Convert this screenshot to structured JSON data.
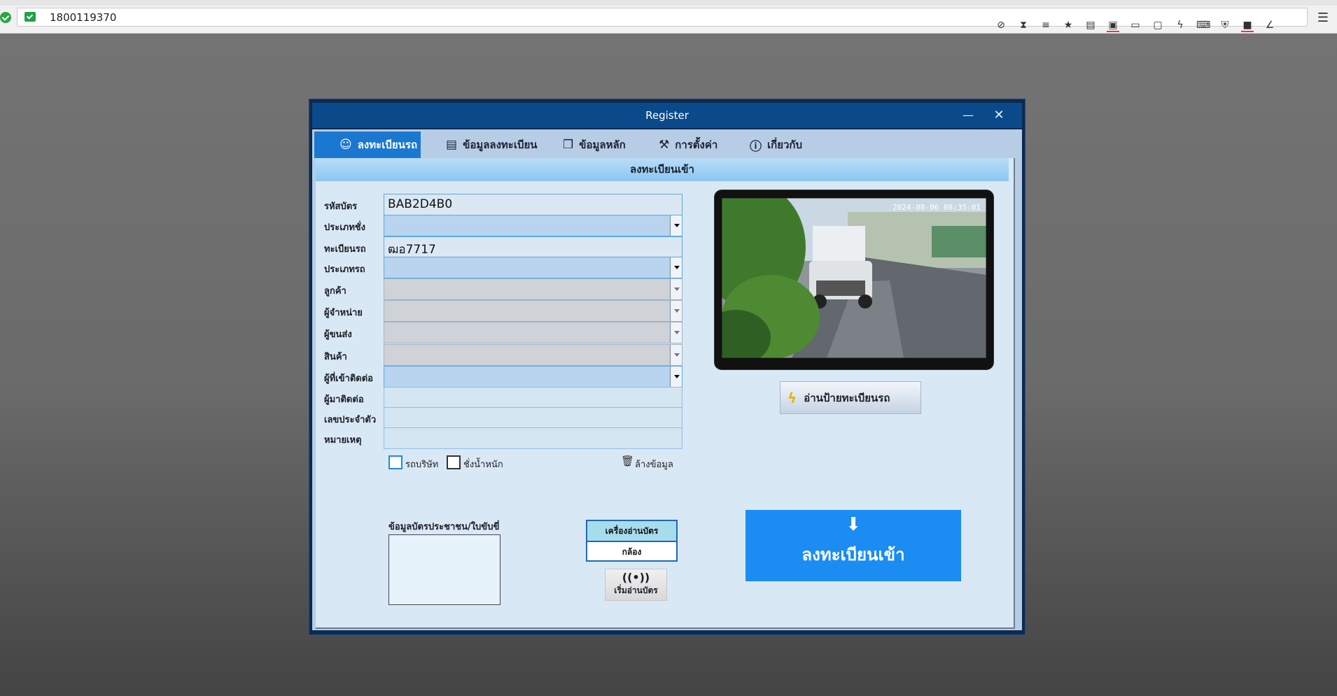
{
  "browser": {
    "address": "1800119370"
  },
  "window": {
    "title": "Register",
    "min_glyph": "—",
    "close_glyph": "✕"
  },
  "tabs": [
    {
      "label": "ลงทะเบียนรถ",
      "icon": "car-icon"
    },
    {
      "label": "ข้อมูลลงทะเบียน",
      "icon": "document-icon"
    },
    {
      "label": "ข้อมูลหลัก",
      "icon": "box-icon"
    },
    {
      "label": "การตั้งค่า",
      "icon": "wrench-icon"
    },
    {
      "label": "เกี่ยวกับ",
      "icon": "info-icon"
    }
  ],
  "section_title": "ลงทะเบียนเข้า",
  "form": {
    "card_id": {
      "label": "รหัสบัตร",
      "value": "BAB2D4B0"
    },
    "weigh_type": {
      "label": "ประเภทชั่ง",
      "value": ""
    },
    "plate": {
      "label": "ทะเบียนรถ",
      "value": "ฒอ7717"
    },
    "vehicle_type": {
      "label": "ประเภทรถ",
      "value": ""
    },
    "customer": {
      "label": "ลูกค้า",
      "value": ""
    },
    "supplier": {
      "label": "ผู้จำหน่าย",
      "value": ""
    },
    "carrier": {
      "label": "ผู้ขนส่ง",
      "value": ""
    },
    "product": {
      "label": "สินค้า",
      "value": ""
    },
    "host_contact": {
      "label": "ผู้ที่เข้าติดต่อ",
      "value": ""
    },
    "visitor": {
      "label": "ผู้มาติดต่อ",
      "value": ""
    },
    "id_number": {
      "label": "เลขประจำตัว",
      "value": ""
    },
    "note": {
      "label": "หมายเหตุ",
      "value": ""
    }
  },
  "options": {
    "company_car": "รถบริษัท",
    "weigh": "ชั่งน้ำหนัก",
    "clear": "ล้างข้อมูล"
  },
  "idcard": {
    "label": "ข้อมูลบัตรประชาชน/ใบขับขี่"
  },
  "reader": {
    "options": [
      "เครื่องอ่านบัตร",
      "กล้อง"
    ],
    "selected": "เครื่องอ่านบัตร",
    "start_label": "เริ่มอ่านบัตร"
  },
  "camera": {
    "timestamp": "2024-08-06 08:35:01"
  },
  "read_plate_label": "อ่านป้ายทะเบียนรถ",
  "register_label": "ลงทะเบียนเข้า",
  "colors": {
    "accent": "#1b8cf2",
    "titlebar": "#0b4a8a",
    "active_tab": "#1a78d0"
  }
}
